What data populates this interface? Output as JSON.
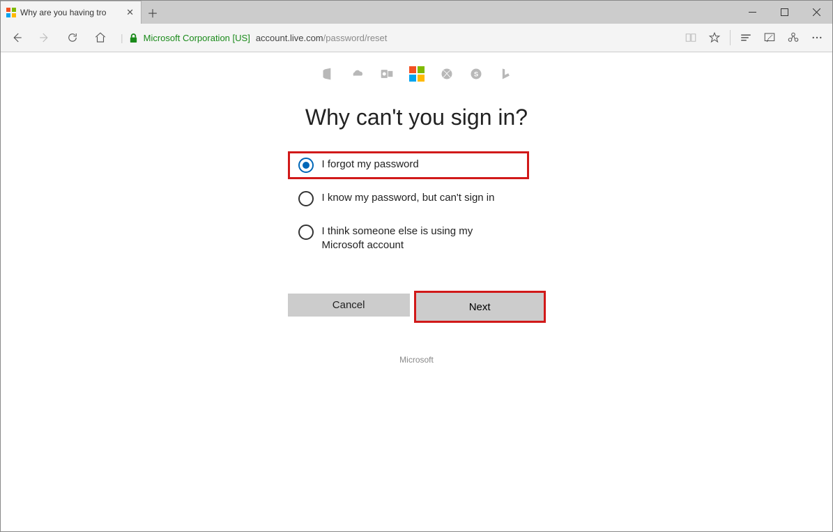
{
  "window": {
    "tab_title": "Why are you having tro",
    "security_org": "Microsoft Corporation [US]",
    "url_host": "account.live.com",
    "url_path": "/password/reset"
  },
  "page": {
    "heading": "Why can't you sign in?",
    "options": [
      {
        "label": "I forgot my password",
        "selected": true,
        "highlight": true
      },
      {
        "label": "I know my password, but can't sign in",
        "selected": false,
        "highlight": false
      },
      {
        "label": "I think someone else is using my Microsoft account",
        "selected": false,
        "highlight": false
      }
    ],
    "buttons": {
      "cancel": "Cancel",
      "next": "Next"
    },
    "footer": "Microsoft"
  }
}
